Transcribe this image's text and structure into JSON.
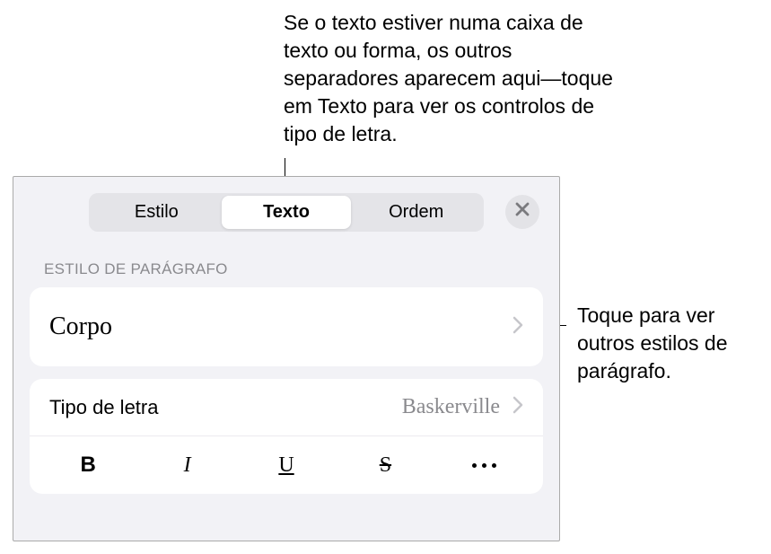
{
  "callouts": {
    "top": "Se o texto estiver numa caixa de texto ou forma, os outros separadores aparecem aqui—toque em Texto para ver os controlos de tipo de letra.",
    "right": "Toque para ver outros estilos de parágrafo."
  },
  "tabs": {
    "style": "Estilo",
    "text": "Texto",
    "order": "Ordem"
  },
  "section_label": "ESTILO DE PARÁGRAFO",
  "paragraph_style": "Corpo",
  "font": {
    "label": "Tipo de letra",
    "value": "Baskerville"
  },
  "style_buttons": {
    "bold": "B",
    "italic": "I",
    "underline": "U",
    "strike": "S"
  }
}
